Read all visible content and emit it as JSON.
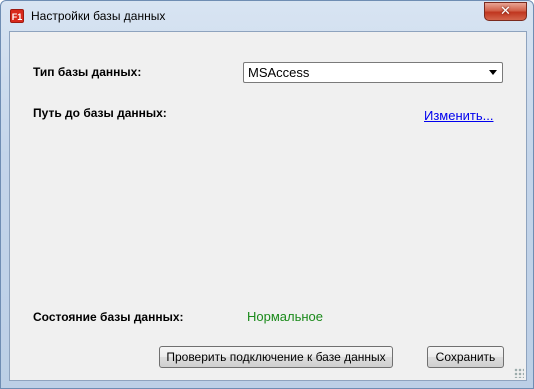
{
  "window": {
    "title": "Настройки базы данных",
    "app_icon_text": "F1",
    "close_glyph": "✕"
  },
  "form": {
    "db_type_label": "Тип базы данных:",
    "db_type_value": "MSAccess",
    "db_path_label": "Путь до базы данных:",
    "change_link": "Изменить...",
    "status_label": "Состояние базы данных:",
    "status_value": "Нормальное"
  },
  "buttons": {
    "check_connection": "Проверить подключение к базе данных",
    "save": "Сохранить"
  },
  "colors": {
    "status_ok": "#1a8a1a",
    "link": "#0000ee",
    "close_button": "#c0361f"
  }
}
